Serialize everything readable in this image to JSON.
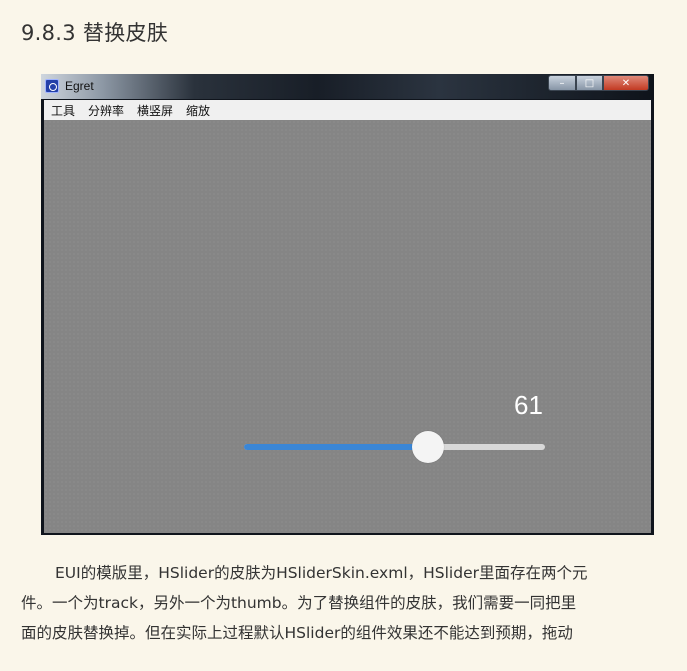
{
  "heading": "9.8.3 替换皮肤",
  "window": {
    "title": "Egret",
    "controls": {
      "minimize": "–",
      "maximize": "□",
      "close": "✕"
    },
    "menu": [
      "工具",
      "分辨率",
      "横竖屏",
      "缩放"
    ],
    "slider": {
      "value_label": "61",
      "value": 61,
      "min": 0,
      "max": 100
    },
    "colors": {
      "background": "#858585",
      "track": "#d8d8d8",
      "fill": "#3a86d6",
      "thumb": "#f4f4f4"
    }
  },
  "body_text": {
    "lines": [
      "EUI的模版里，HSlider的皮肤为HSliderSkin.exml，HSlider里面存在两个元",
      "件。一个为track，另外一个为thumb。为了替换组件的皮肤，我们需要一同把里",
      "面的皮肤替换掉。但在实际上过程默认HSlider的组件效果还不能达到预期，拖动"
    ]
  }
}
